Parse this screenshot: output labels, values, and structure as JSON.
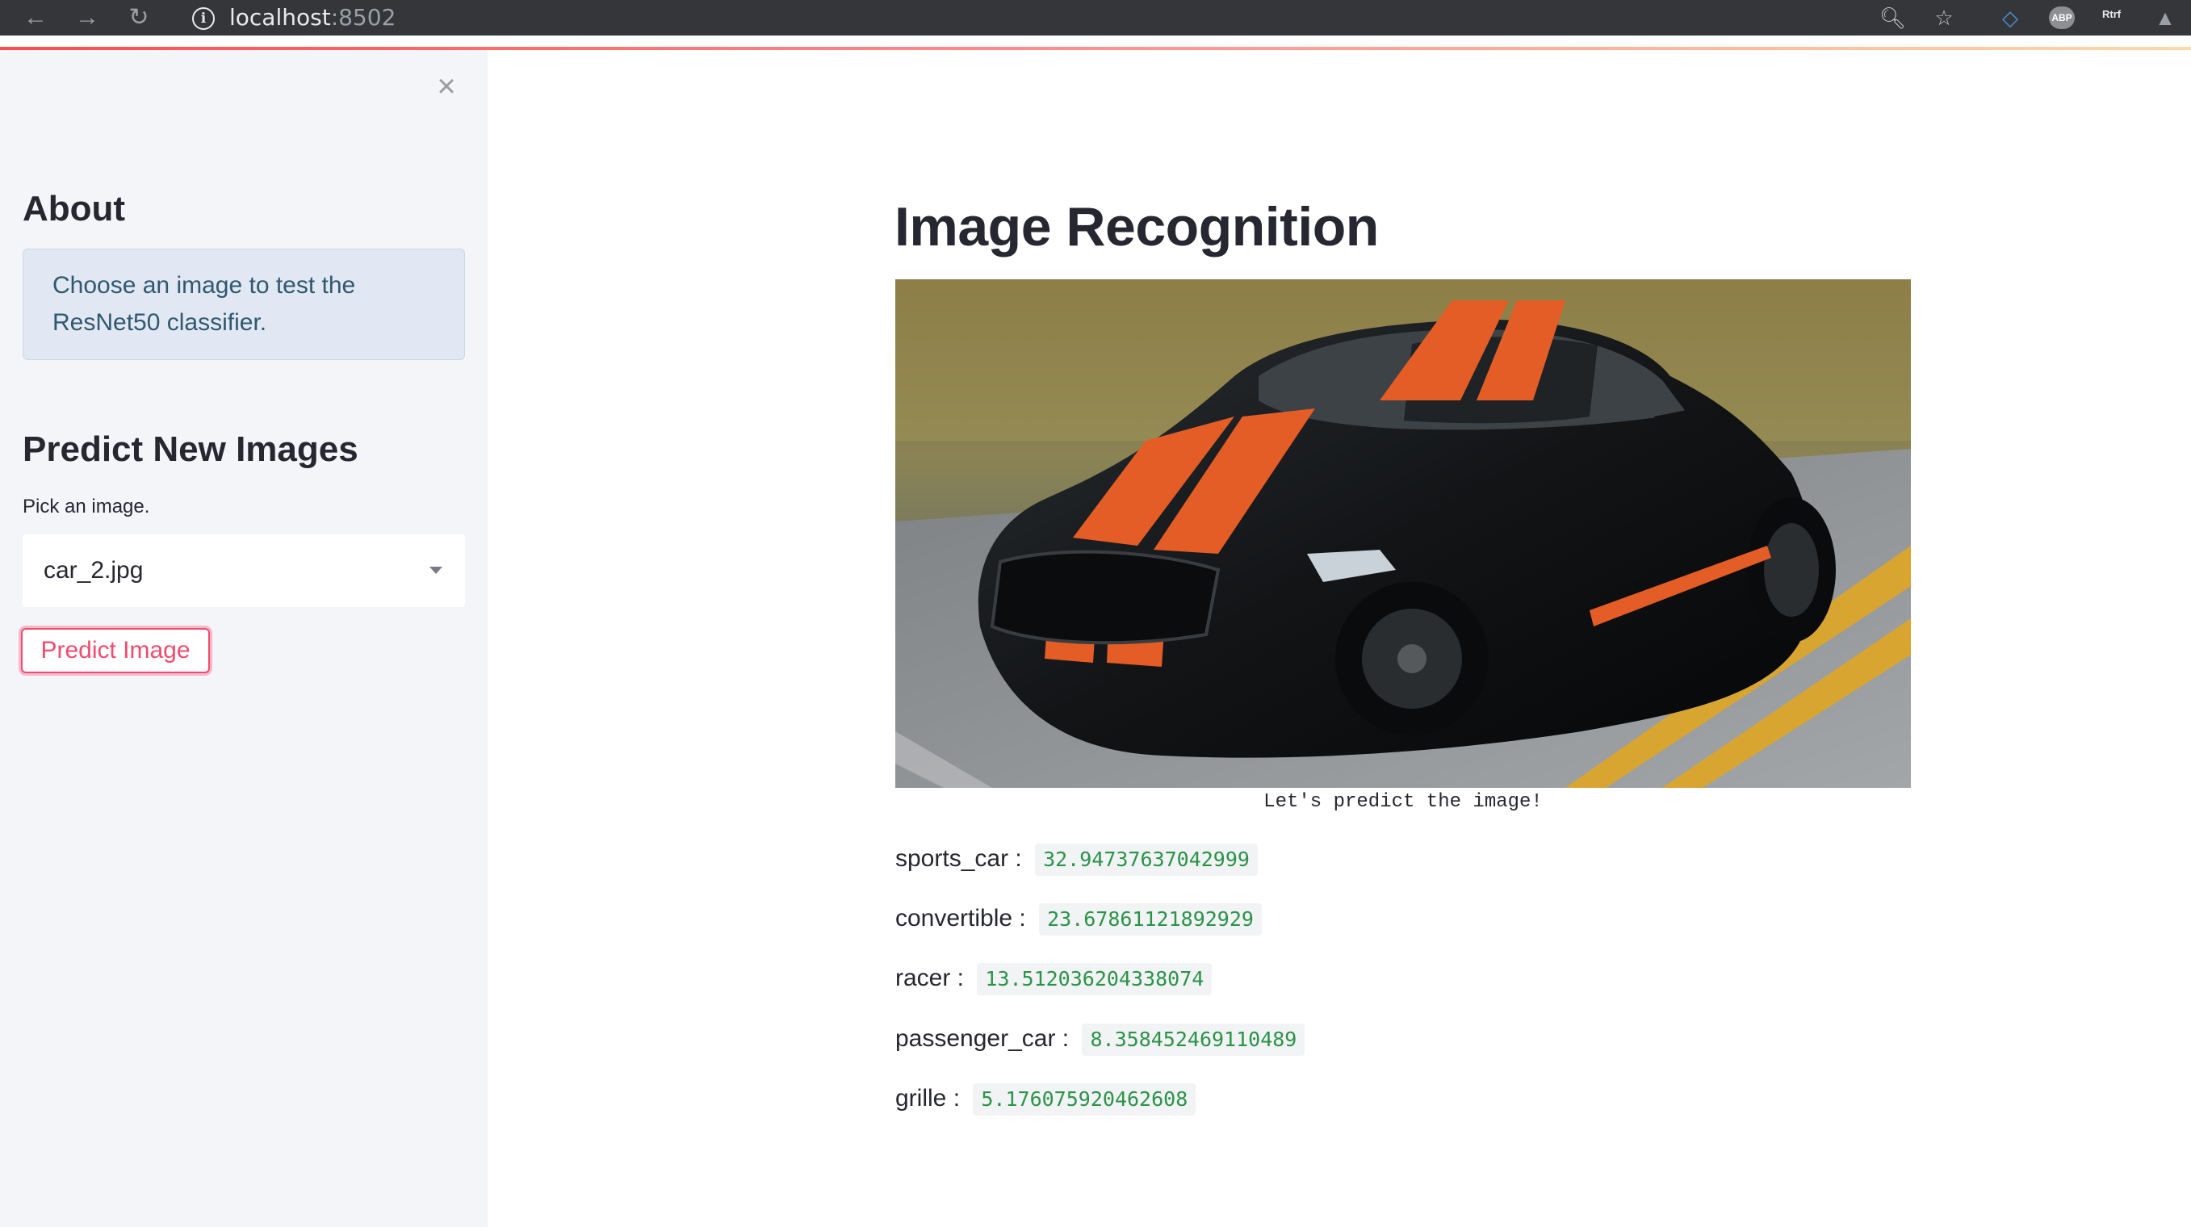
{
  "browser": {
    "url_host": "localhost",
    "url_port": ":8502",
    "back_icon": "arrow-left-icon",
    "forward_icon": "arrow-right-icon",
    "reload_icon": "reload-icon",
    "ext_abp_label": "ABP",
    "ext_text_label": "Rtrf"
  },
  "sidebar": {
    "about_heading": "About",
    "about_text": "Choose an image to test the ResNet50 classifier.",
    "predict_heading": "Predict New Images",
    "pick_label": "Pick an image.",
    "selected_image": "car_2.jpg",
    "predict_button": "Predict Image"
  },
  "main": {
    "title": "Image Recognition",
    "image_caption": "Let's predict the image!",
    "predictions": [
      {
        "label": "sports_car :",
        "score": "32.94737637042999"
      },
      {
        "label": "convertible :",
        "score": "23.67861121892929"
      },
      {
        "label": "racer :",
        "score": "13.512036204338074"
      },
      {
        "label": "passenger_car :",
        "score": "8.358452469110489"
      },
      {
        "label": "grille :",
        "score": "5.176075920462608"
      }
    ]
  },
  "colors": {
    "accent": "#ff4b4b",
    "score_text": "#2b9348",
    "info_bg": "#e1e8f3"
  }
}
